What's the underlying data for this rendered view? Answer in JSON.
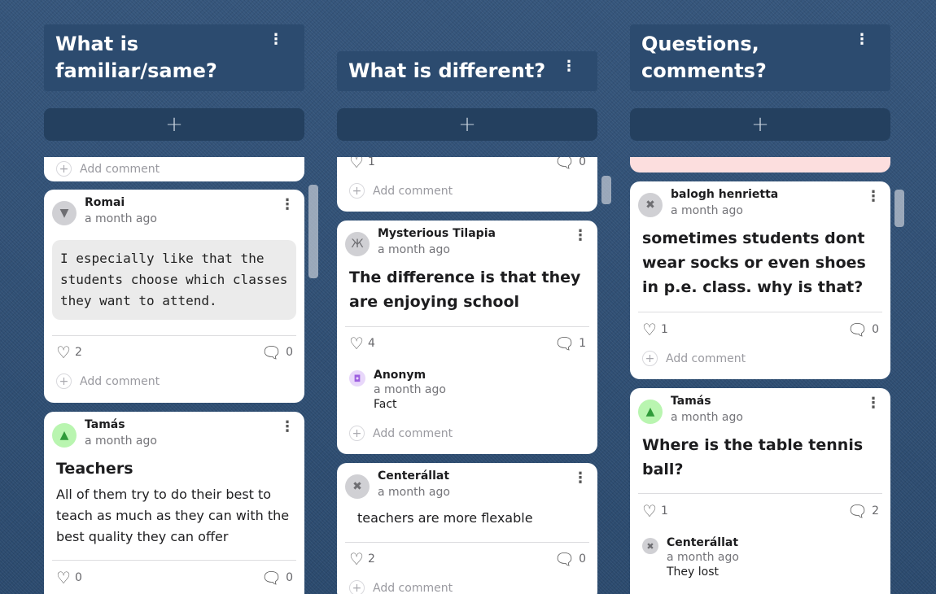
{
  "columns": [
    {
      "title": "What is familiar/same?",
      "menu": "⋮",
      "add": "+",
      "cards": [
        {
          "like_count": "",
          "comment_count": "",
          "add_comment": "Add comment"
        },
        {
          "author": "Romai",
          "time": "a month ago",
          "quote": "I especially like that the students choose which classes they want to attend.",
          "likes": "2",
          "comments": "0",
          "add_comment": "Add comment"
        },
        {
          "author": "Tamás",
          "time": "a month ago",
          "title": "Teachers",
          "body": "All of them try to do their best to teach as much as they can with the best quality they can offer",
          "likes": "0",
          "comments": "0"
        }
      ]
    },
    {
      "title": "What is different?",
      "menu": "⋮",
      "add": "+",
      "cards": [
        {
          "likes": "1",
          "comments": "0",
          "add_comment": "Add comment"
        },
        {
          "author": "Mysterious Tilapia",
          "time": "a month ago",
          "title": "The difference is that  they are enjoying school",
          "likes": "4",
          "comments": "1",
          "reply": {
            "author": "Anonym",
            "time": "a month ago",
            "text": "Fact"
          },
          "add_comment": "Add comment"
        },
        {
          "author": "Centerállat",
          "time": "a month ago",
          "body": "teachers are more flexable",
          "likes": "2",
          "comments": "0",
          "add_comment": "Add comment"
        }
      ]
    },
    {
      "title": "Questions, comments?",
      "menu": "⋮",
      "add": "+",
      "cards": [
        {
          "author": "balogh henrietta",
          "time": "a month ago",
          "title": "sometimes students dont wear socks or even shoes in p.e. class. why is that?",
          "likes": "1",
          "comments": "0",
          "add_comment": "Add comment"
        },
        {
          "author": "Tamás",
          "time": "a month ago",
          "title": "Where is the table tennis ball?",
          "likes": "1",
          "comments": "2",
          "reply": {
            "author": "Centerállat",
            "time": "a month ago",
            "text": "They lost"
          }
        }
      ]
    }
  ],
  "icons": {
    "heart": "heart-icon",
    "comment": "comment-bubble-icon",
    "plus": "plus-icon",
    "menu": "more-vertical-icon"
  },
  "colors": {
    "header_bg": "#2c4b6f",
    "add_bar_bg": "#24405f",
    "card_bg": "#ffffff",
    "pink_card": "#fcdede",
    "board_bg": "#2f4f74"
  }
}
